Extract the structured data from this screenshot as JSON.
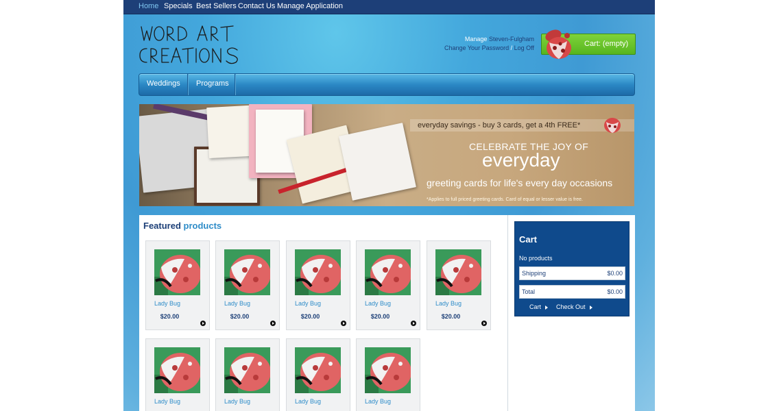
{
  "nav": {
    "items": [
      {
        "label": "Home",
        "active": true
      },
      {
        "label": "Specials"
      },
      {
        "label": "Best Sellers"
      },
      {
        "label": "Contact Us"
      },
      {
        "label": "Manage Application"
      }
    ]
  },
  "logo": {
    "line1": "WORD ART",
    "line2": "CREATIONS"
  },
  "account": {
    "manage_label": "Manage",
    "user": "Steven-Fulgham",
    "change_password": "Change Your Password",
    "separator": "/",
    "logoff": "Log Off"
  },
  "cart_button": {
    "label": "Cart: (empty)",
    "icon": "ladybug-icon"
  },
  "main_menu": {
    "items": [
      {
        "label": "Weddings"
      },
      {
        "label": "Programs"
      }
    ]
  },
  "banner": {
    "savings": "everyday savings - buy 3 cards, get a 4th FREE*",
    "headline1": "CELEBRATE THE JOY OF",
    "headline2": "everyday",
    "tagline": "greeting cards for life's every day occasions",
    "footnote": "*Applies to full priced greeting cards. Card of equal or lesser value is free."
  },
  "featured": {
    "title_a": "Featured",
    "title_b": "products",
    "products": [
      {
        "name": "Lady Bug",
        "price": "$20.00"
      },
      {
        "name": "Lady Bug",
        "price": "$20.00"
      },
      {
        "name": "Lady Bug",
        "price": "$20.00"
      },
      {
        "name": "Lady Bug",
        "price": "$20.00"
      },
      {
        "name": "Lady Bug",
        "price": "$20.00"
      },
      {
        "name": "Lady Bug",
        "price": ""
      },
      {
        "name": "Lady Bug",
        "price": ""
      },
      {
        "name": "Lady Bug",
        "price": ""
      },
      {
        "name": "Lady Bug",
        "price": ""
      }
    ]
  },
  "cart": {
    "title": "Cart",
    "no_products": "No products",
    "shipping_label": "Shipping",
    "shipping_value": "$0.00",
    "total_label": "Total",
    "total_value": "$0.00",
    "cart_link": "Cart",
    "checkout_link": "Check Out"
  },
  "colors": {
    "nav_bg": "#1d3f78",
    "accent_blue": "#2e8cc8",
    "dark_blue": "#1c3f77",
    "cart_green": "#6cc52c",
    "cart_box": "#0f4a8c"
  }
}
